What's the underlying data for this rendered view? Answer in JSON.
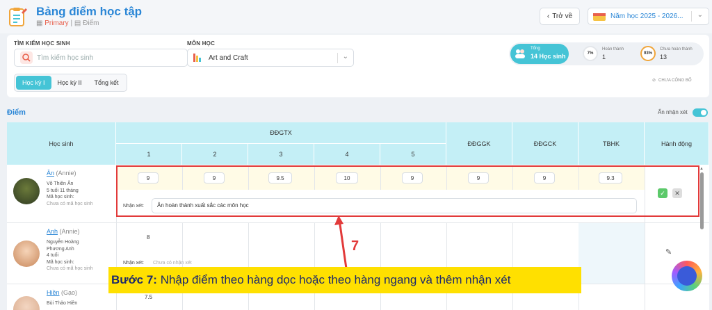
{
  "header": {
    "title": "Bảng điểm học tập",
    "crumb_primary": "Primary",
    "crumb_separator": "|",
    "crumb_scores": "Điểm"
  },
  "actions": {
    "back_label": "Trở về",
    "school_year": "Năm học 2025 - 2026..."
  },
  "filters": {
    "search_label": "TÌM KIẾM HỌC SINH",
    "search_placeholder": "Tìm kiếm học sinh",
    "subject_label": "MÔN HỌC",
    "subject_value": "Art and Craft",
    "tabs": [
      "Học kỳ I",
      "Học kỳ II",
      "Tổng kết"
    ]
  },
  "stats": {
    "total_label": "Tổng",
    "total_value": "14 Học sinh",
    "done_percent": "7%",
    "done_label": "Hoàn thành",
    "done_value": "1",
    "undone_percent": "93%",
    "undone_label": "Chưa hoàn thành",
    "undone_value": "13",
    "unpublished": "CHƯA CÔNG BỐ"
  },
  "section": {
    "title": "Điểm",
    "hide_comment": "Ẩn nhận xét"
  },
  "table": {
    "col_student": "Học sinh",
    "col_ddgtx": "ĐĐGTX",
    "sub_cols": [
      "1",
      "2",
      "3",
      "4",
      "5"
    ],
    "col_ddggk": "ĐĐGGK",
    "col_ddgck": "ĐĐGCK",
    "col_tbhk": "TBHK",
    "col_action": "Hành động",
    "comment_label": "Nhận xét:"
  },
  "students": [
    {
      "name": "Ân",
      "nickname": "(Annie)",
      "full_name": "Võ Thiên Ân",
      "age": "5 tuổi 11 tháng",
      "code_label": "Mã học sinh:",
      "code_value": "Chưa có mã học sinh",
      "scores": [
        "9",
        "9",
        "9.5",
        "10",
        "9"
      ],
      "ddggk": "9",
      "ddgck": "9",
      "tbhk": "9.3",
      "comment": "Ân hoàn thành xuất sắc các môn học"
    },
    {
      "name": "Anh",
      "nickname": "(Annie)",
      "full_name_1": "Nguyễn Hoàng",
      "full_name_2": "Phương Anh",
      "age": "4 tuổi",
      "code_label": "Mã học sinh:",
      "code_value": "Chưa có mã học sinh",
      "score_1": "8",
      "comment_placeholder": "Chưa có nhận xét"
    },
    {
      "name": "Hiền",
      "nickname": "(Gạo)",
      "full_name": "Bùi Thảo Hiền",
      "score_1": "7.5"
    }
  ],
  "annotation": {
    "step_number": "7",
    "banner_bold": "Bước 7:",
    "banner_text": " Nhập điểm theo hàng dọc hoặc theo hàng ngang và thêm nhận xét"
  },
  "colors": {
    "accent": "#45c4d6",
    "title": "#2a86d6",
    "highlight_border": "#e23a3a",
    "banner": "#ffe000"
  }
}
